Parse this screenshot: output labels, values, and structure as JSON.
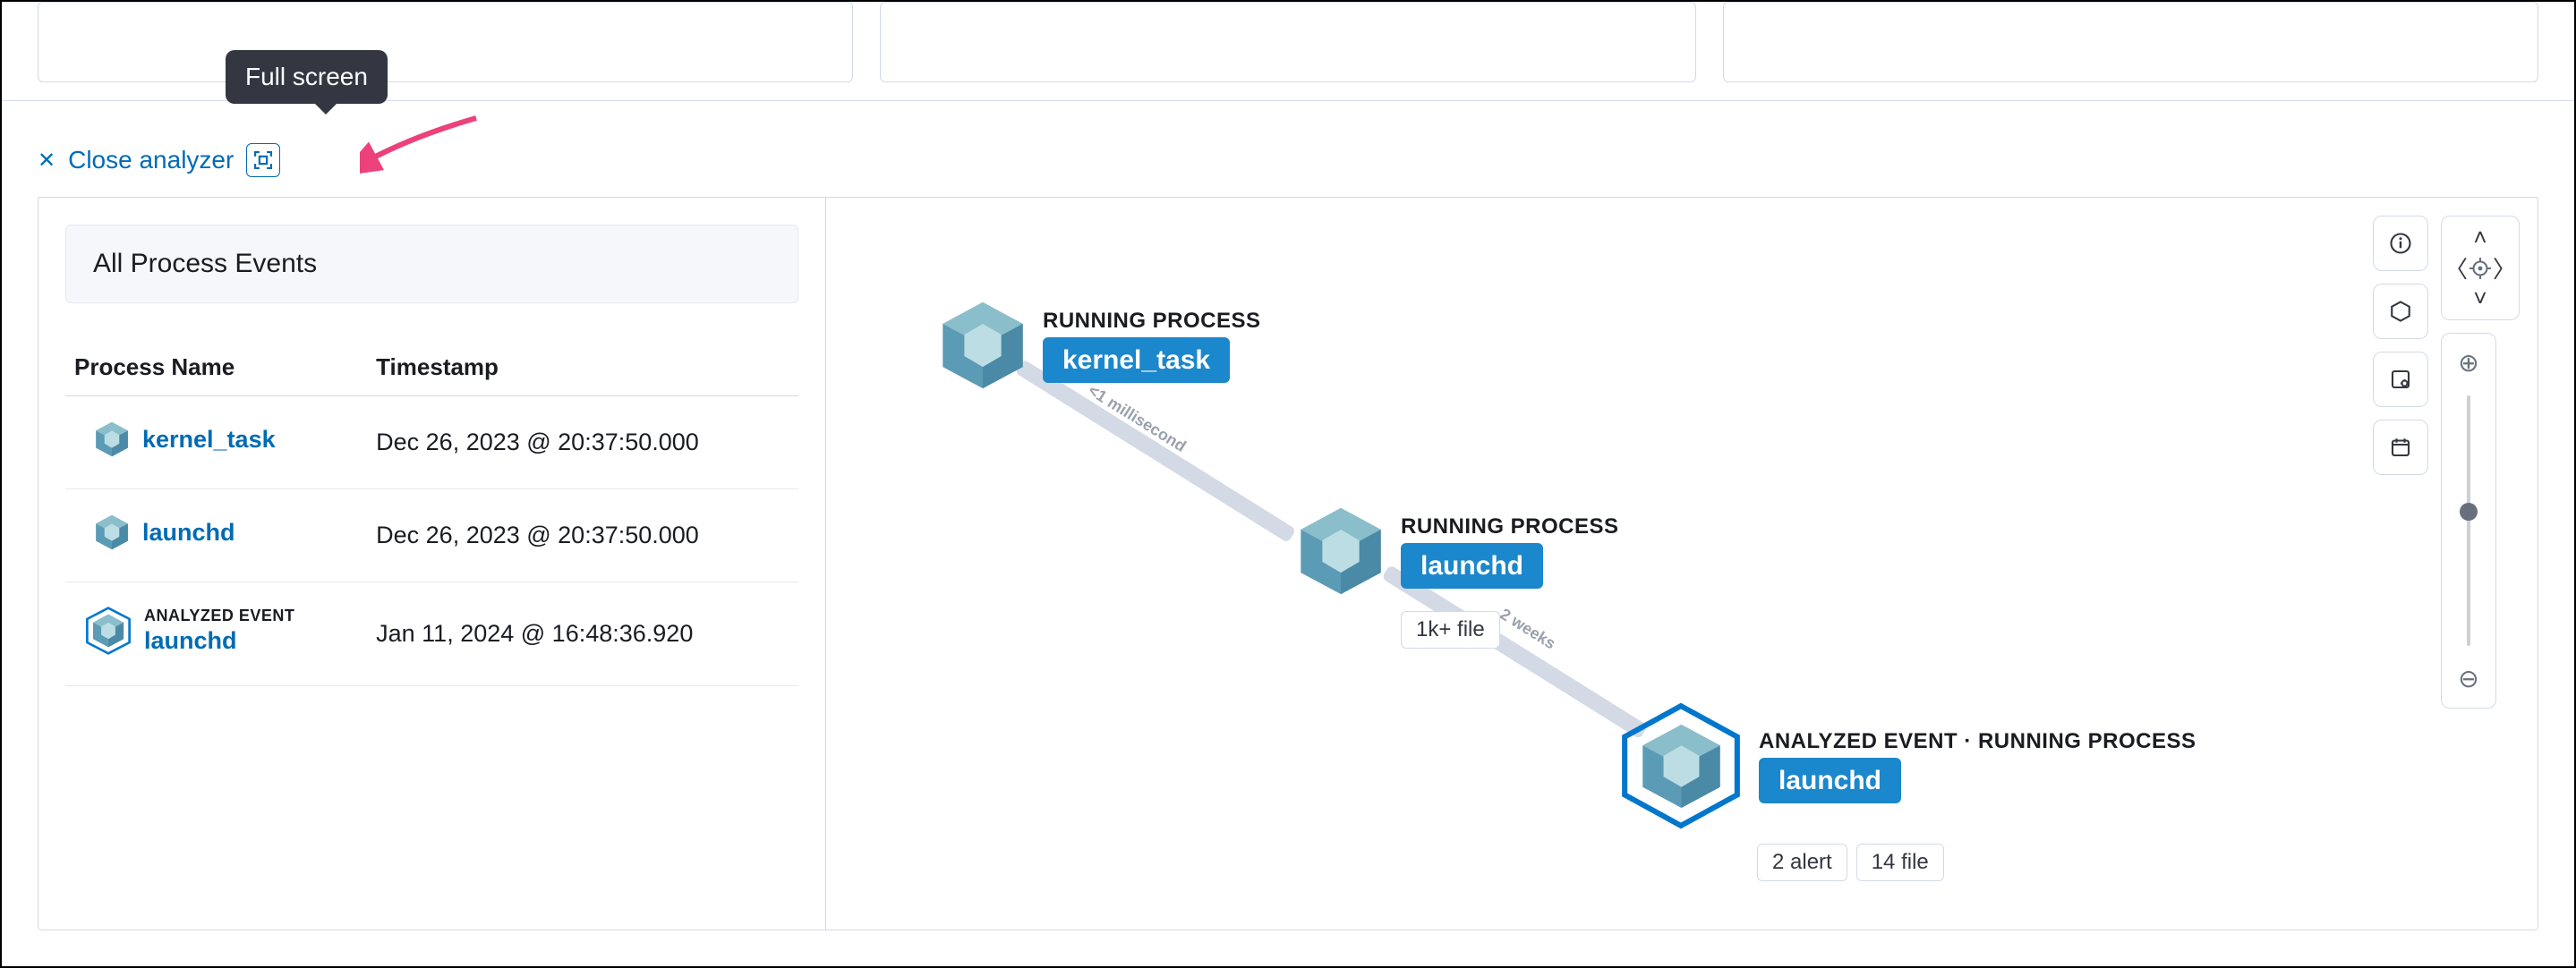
{
  "tooltip": {
    "label": "Full screen"
  },
  "close": {
    "label": "Close analyzer"
  },
  "sidebar": {
    "header": "All Process Events",
    "columns": {
      "name": "Process Name",
      "ts": "Timestamp"
    },
    "rows": [
      {
        "name": "kernel_task",
        "ts": "Dec 26, 2023 @ 20:37:50.000",
        "analyzed": false
      },
      {
        "name": "launchd",
        "ts": "Dec 26, 2023 @ 20:37:50.000",
        "analyzed": false
      },
      {
        "name": "launchd",
        "ts": "Jan 11, 2024 @ 16:48:36.920",
        "analyzed": true,
        "subtitle": "ANALYZED EVENT"
      }
    ]
  },
  "graph": {
    "nodes": [
      {
        "title": "RUNNING PROCESS",
        "name": "kernel_task",
        "pills": []
      },
      {
        "title": "RUNNING PROCESS",
        "name": "launchd",
        "pills": [
          "1k+ file"
        ]
      },
      {
        "title": "ANALYZED EVENT · RUNNING PROCESS",
        "name": "launchd",
        "pills": [
          "2 alert",
          "14 file"
        ],
        "analyzed": true
      }
    ],
    "edges": [
      {
        "label": "<1 millisecond"
      },
      {
        "label": "2 weeks"
      }
    ]
  }
}
